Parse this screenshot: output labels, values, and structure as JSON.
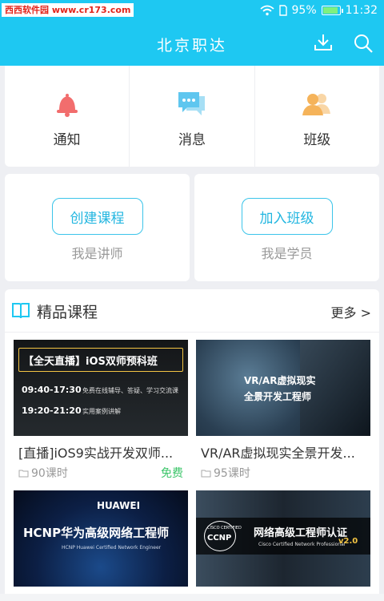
{
  "status": {
    "watermark_cn": "西西软件园",
    "watermark_url": "www.cr173.com",
    "battery": "95%",
    "battery_level": 0.95,
    "time": "11:32"
  },
  "app_bar": {
    "title": "北京职达",
    "download_icon": "download-icon",
    "search_icon": "search-icon"
  },
  "quick": {
    "items": [
      {
        "label": "通知",
        "icon": "bell-icon",
        "color": "#f26d6d"
      },
      {
        "label": "消息",
        "icon": "chat-icon",
        "color": "#5fc6ef"
      },
      {
        "label": "班级",
        "icon": "people-icon",
        "color": "#f5b35a"
      }
    ]
  },
  "roles": {
    "teacher": {
      "button": "创建课程",
      "sub": "我是讲师"
    },
    "student": {
      "button": "加入班级",
      "sub": "我是学员"
    }
  },
  "featured": {
    "title": "精品课程",
    "more": "更多 >",
    "courses": [
      {
        "name": "[直播]iOS9实战开发双师...",
        "hours": "90课时",
        "price": "免费",
        "thumb_title": "【全天直播】iOS双师预科班",
        "thumb_line1_time": "09:40-17:30",
        "thumb_line1_text": "免费在线辅导、答疑、学习交流课",
        "thumb_line2_time": "19:20-21:20",
        "thumb_line2_text": "实用案例讲解"
      },
      {
        "name": "VR/AR虚拟现实全景开发...",
        "hours": "95课时",
        "price": "",
        "thumb_line1": "VR/AR虚拟现实",
        "thumb_line2": "全景开发工程师"
      },
      {
        "thumb_brand": "HUAWEI",
        "thumb_title": "HCNP华为高级网络工程师",
        "thumb_sub": "HCNP Huawei Certified Network Engineer"
      },
      {
        "thumb_cisco": "CISCO CERTIFIED",
        "thumb_ccnp": "CCNP",
        "thumb_title": "网络高级工程师认证",
        "thumb_sub": "Cisco Certified Network Professional",
        "thumb_version": "v2.0"
      }
    ]
  }
}
